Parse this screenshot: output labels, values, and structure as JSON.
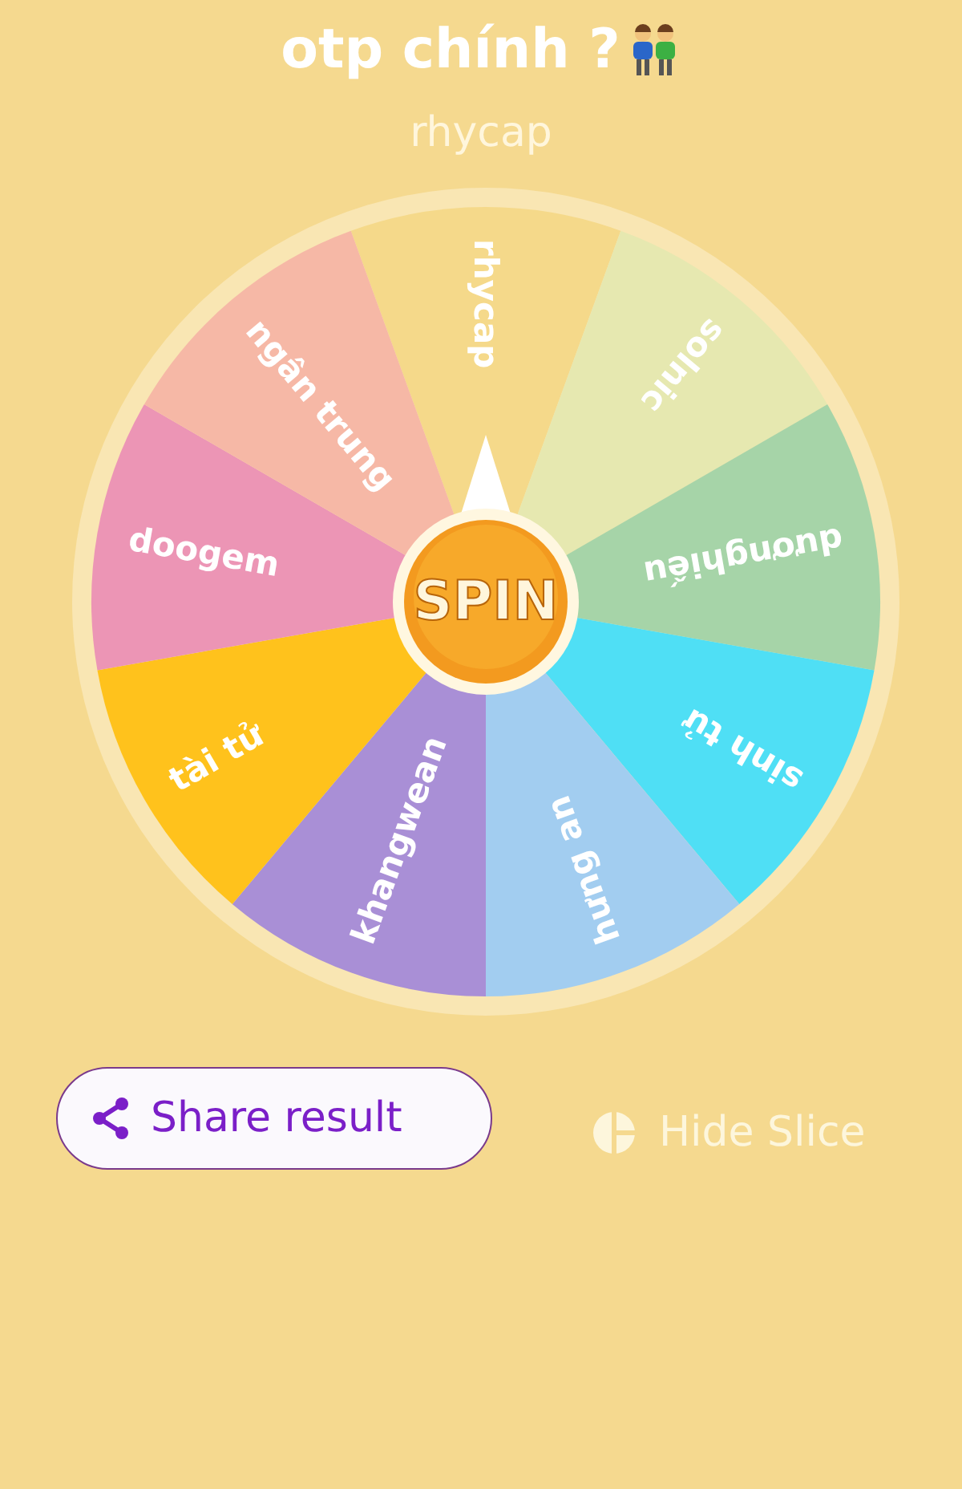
{
  "title": "otp chính ?",
  "result": "rhycap",
  "wheel": {
    "spin_label": "SPIN",
    "slices": [
      {
        "label": "rhycap",
        "color": "#f5d98a"
      },
      {
        "label": "solnic",
        "color": "#e6e8b0"
      },
      {
        "label": "dươnghiếu",
        "color": "#a6d4a8"
      },
      {
        "label": "sinh tử",
        "color": "#4fdff5"
      },
      {
        "label": "hưng an",
        "color": "#a2cdf0"
      },
      {
        "label": "khangwean",
        "color": "#a98fd6"
      },
      {
        "label": "tài tử",
        "color": "#ffc21c"
      },
      {
        "label": "doogem",
        "color": "#ec95b5"
      },
      {
        "label": "ngân trung",
        "color": "#f6b8a6"
      }
    ]
  },
  "actions": {
    "share": "Share result",
    "hide_slice": "Hide Slice"
  }
}
